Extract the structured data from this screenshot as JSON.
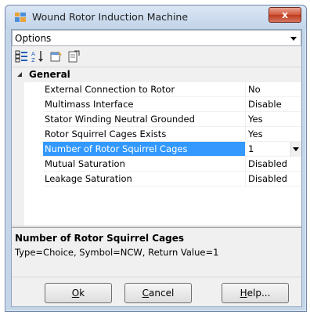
{
  "window": {
    "title": "Wound Rotor Induction Machine",
    "close_label": "x"
  },
  "selector": {
    "value": "Options"
  },
  "toolbar": {
    "icons": [
      "categorized-icon",
      "alphabetical-sort-icon",
      "property-pages-icon",
      "export-icon"
    ]
  },
  "grid": {
    "category": "General",
    "rows": [
      {
        "name": "External Connection to Rotor",
        "value": "No"
      },
      {
        "name": "Multimass Interface",
        "value": "Disable"
      },
      {
        "name": "Stator Winding Neutral Grounded",
        "value": "Yes"
      },
      {
        "name": "Rotor Squirrel Cages Exists",
        "value": "Yes"
      },
      {
        "name": "Number of Rotor Squirrel Cages",
        "value": "1"
      },
      {
        "name": "Mutual Saturation",
        "value": "Disabled"
      },
      {
        "name": "Leakage Saturation",
        "value": "Disabled"
      }
    ],
    "selected_index": 4
  },
  "description": {
    "title": "Number of Rotor Squirrel Cages",
    "text": "Type=Choice, Symbol=NCW, Return Value=1"
  },
  "buttons": {
    "ok": {
      "mnemonic": "O",
      "rest": "k"
    },
    "cancel": {
      "mnemonic": "C",
      "rest": "ancel"
    },
    "help": {
      "mnemonic": "H",
      "rest": "elp..."
    }
  },
  "colors": {
    "selection": "#3399ff",
    "close": "#c13b1d"
  }
}
